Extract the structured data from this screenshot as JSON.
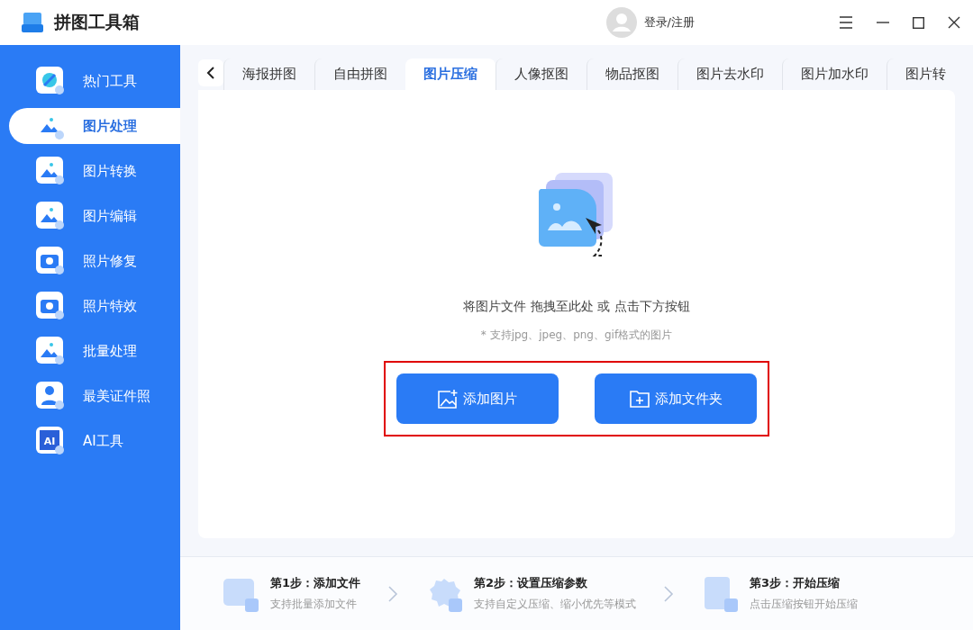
{
  "app": {
    "title": "拼图工具箱",
    "login": "登录/注册"
  },
  "sidebar": {
    "items": [
      {
        "label": "热门工具",
        "selected": false
      },
      {
        "label": "图片处理",
        "selected": true
      },
      {
        "label": "图片转换",
        "selected": false
      },
      {
        "label": "图片编辑",
        "selected": false
      },
      {
        "label": "照片修复",
        "selected": false
      },
      {
        "label": "照片特效",
        "selected": false
      },
      {
        "label": "批量处理",
        "selected": false
      },
      {
        "label": "最美证件照",
        "selected": false
      },
      {
        "label": "AI工具",
        "selected": false,
        "icon_text": "AI"
      }
    ]
  },
  "tabs": [
    {
      "label": "海报拼图",
      "selected": false
    },
    {
      "label": "自由拼图",
      "selected": false
    },
    {
      "label": "图片压缩",
      "selected": true
    },
    {
      "label": "人像抠图",
      "selected": false
    },
    {
      "label": "物品抠图",
      "selected": false
    },
    {
      "label": "图片去水印",
      "selected": false
    },
    {
      "label": "图片加水印",
      "selected": false
    },
    {
      "label": "图片转",
      "selected": false
    }
  ],
  "dropzone": {
    "instruction": "将图片文件 拖拽至此处 或 点击下方按钮",
    "formats": "* 支持jpg、jpeg、png、gif格式的图片",
    "buttons": [
      {
        "label": "添加图片",
        "kind": "image"
      },
      {
        "label": "添加文件夹",
        "kind": "folder"
      }
    ]
  },
  "steps": [
    {
      "title": "第1步：添加文件",
      "subtitle": "支持批量添加文件",
      "kind": "image"
    },
    {
      "title": "第2步：设置压缩参数",
      "subtitle": "支持自定义压缩、缩小优先等模式",
      "kind": "gear"
    },
    {
      "title": "第3步：开始压缩",
      "subtitle": "点击压缩按钮开始压缩",
      "kind": "doc"
    }
  ]
}
